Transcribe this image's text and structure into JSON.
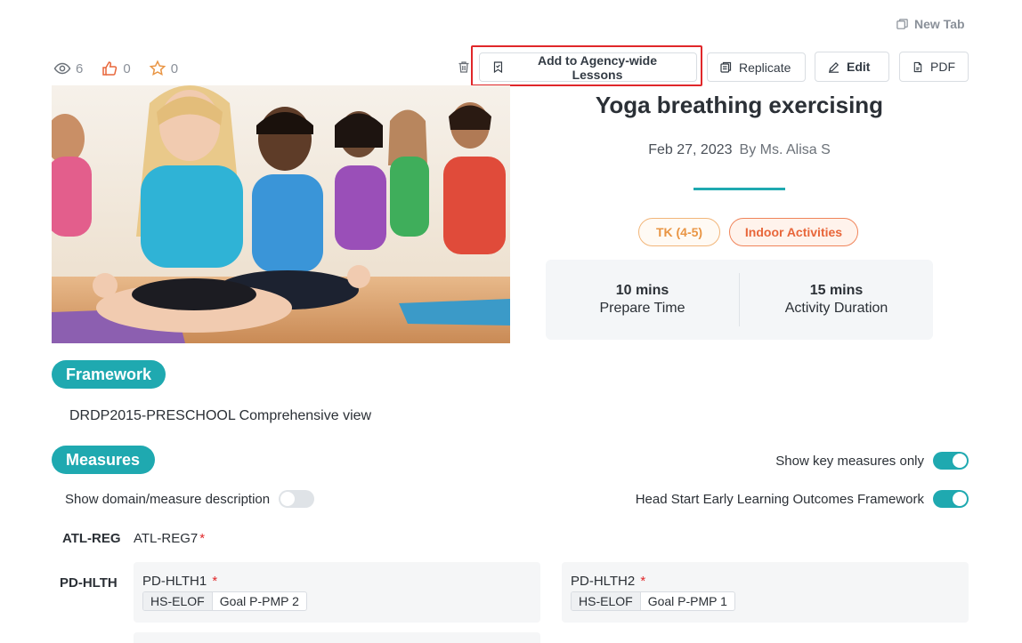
{
  "header": {
    "new_tab_label": "New Tab"
  },
  "stats": {
    "views": "6",
    "likes": "0",
    "favorites": "0"
  },
  "toolbar": {
    "agency_label": "Add to Agency-wide Lessons",
    "replicate_label": "Replicate",
    "edit_label": "Edit",
    "pdf_label": "PDF"
  },
  "lesson": {
    "title": "Yoga breathing exercising",
    "date": "Feb 27, 2023",
    "author": "By Ms. Alisa S",
    "tags": [
      "TK (4-5)",
      "Indoor Activities"
    ],
    "prepare_time_value": "10 mins",
    "prepare_time_label": "Prepare Time",
    "activity_duration_value": "15 mins",
    "activity_duration_label": "Activity Duration"
  },
  "framework": {
    "heading": "Framework",
    "name": "DRDP2015-PRESCHOOL Comprehensive view"
  },
  "measures": {
    "heading": "Measures",
    "show_key_label": "Show key measures only",
    "show_key_on": true,
    "show_desc_label": "Show domain/measure description",
    "show_desc_on": false,
    "hs_label": "Head Start Early Learning Outcomes Framework",
    "hs_on": true,
    "domains": [
      {
        "label": "ATL-REG",
        "measure": "ATL-REG7",
        "required": "*"
      },
      {
        "label": "PD-HLTH",
        "items": [
          {
            "name": "PD-HLTH1",
            "required": "*",
            "framework": "HS-ELOF",
            "goal": "Goal P-PMP 2"
          },
          {
            "name": "PD-HLTH2",
            "required": "*",
            "framework": "HS-ELOF",
            "goal": "Goal P-PMP 1"
          }
        ]
      }
    ]
  },
  "colors": {
    "accent": "#1fa9b0",
    "highlight": "#e0272a",
    "tag_age": "#e99544",
    "tag_category": "#e8663a"
  }
}
